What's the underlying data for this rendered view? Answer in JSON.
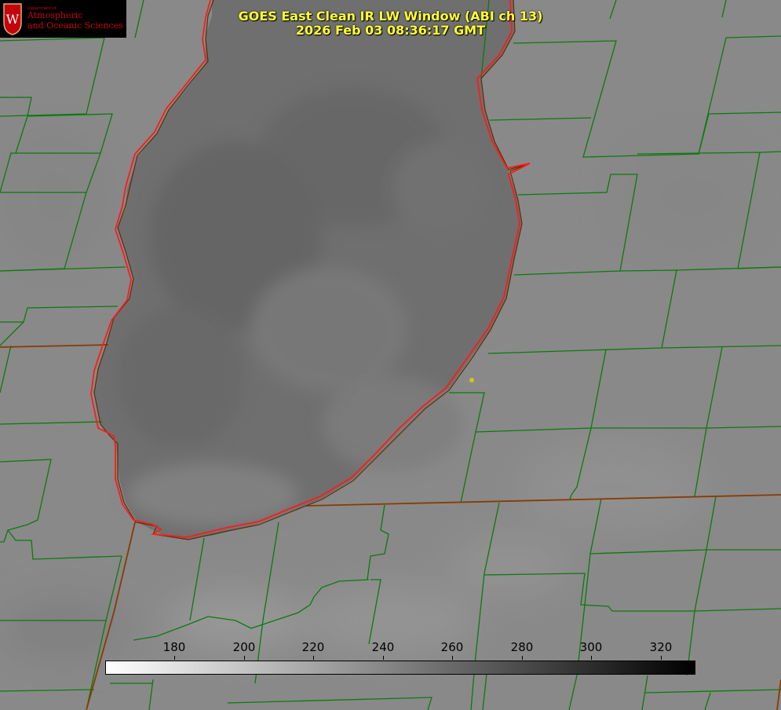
{
  "title": {
    "line1": "GOES East Clean IR LW Window (ABI ch 13)",
    "line2": "2026 Feb 03 08:36:17 GMT"
  },
  "logo": {
    "dept": "Department of",
    "line1": "Atmospheric",
    "line2": "and Oceanic Sciences",
    "seal_letter": "W"
  },
  "colorbar": {
    "min": 160,
    "max": 330,
    "ticks": [
      "180",
      "200",
      "220",
      "240",
      "260",
      "280",
      "300",
      "320"
    ],
    "colors": {
      "low": "#ffffff",
      "high": "#000000"
    }
  },
  "colors": {
    "background": "#8a8a8a",
    "lake": "#6e6e6e",
    "county_lines": "#0c7a0c",
    "state_lines": "#8a3a00",
    "shoreline": "#ff1a1a",
    "title": "#ffff33",
    "marker": "#d4c21a"
  }
}
